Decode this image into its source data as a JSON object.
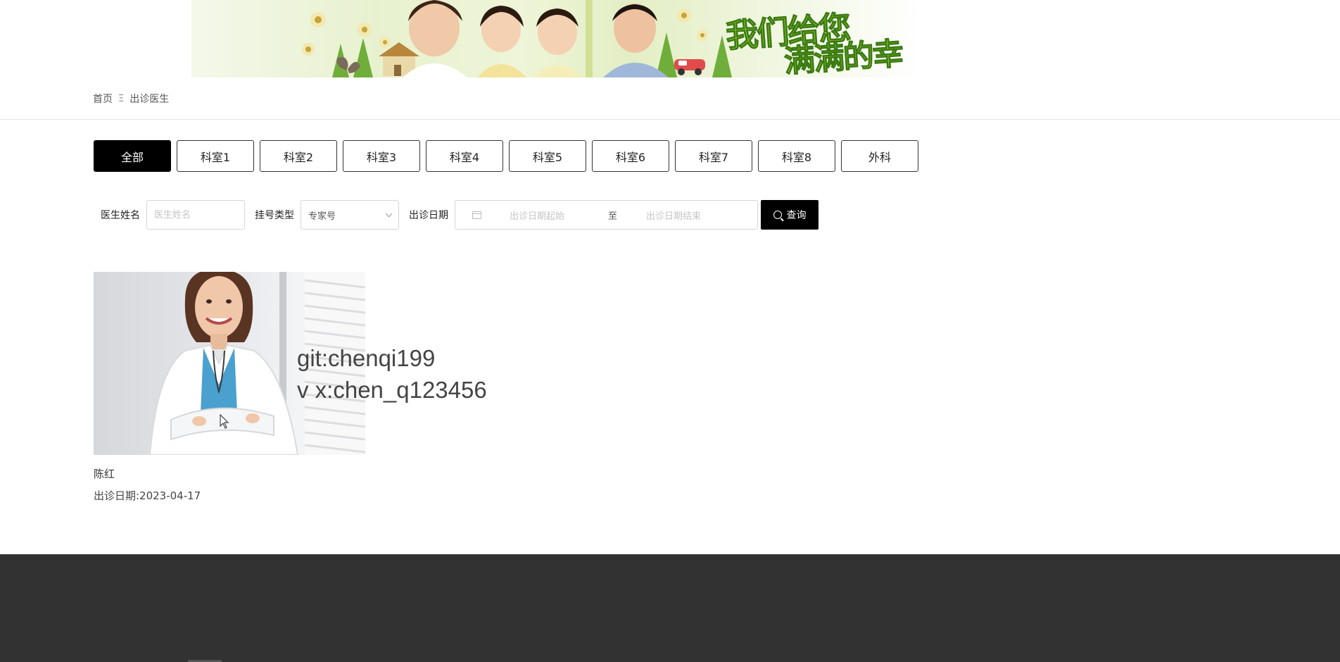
{
  "banner": {
    "slogan_line1": "我们给您",
    "slogan_line2": "满满的幸福"
  },
  "breadcrumb": {
    "home": "首页",
    "separator": "Ξ",
    "current": "出诊医生"
  },
  "departments": [
    {
      "label": "全部",
      "active": true
    },
    {
      "label": "科室1",
      "active": false
    },
    {
      "label": "科室2",
      "active": false
    },
    {
      "label": "科室3",
      "active": false
    },
    {
      "label": "科室4",
      "active": false
    },
    {
      "label": "科室5",
      "active": false
    },
    {
      "label": "科室6",
      "active": false
    },
    {
      "label": "科室7",
      "active": false
    },
    {
      "label": "科室8",
      "active": false
    },
    {
      "label": "外科",
      "active": false
    }
  ],
  "search": {
    "doctor_name_label": "医生姓名",
    "doctor_name_placeholder": "医生姓名",
    "doctor_name_value": "",
    "reg_type_label": "挂号类型",
    "reg_type_value": "专家号",
    "date_label": "出诊日期",
    "date_start_placeholder": "出诊日期起始",
    "date_separator": "至",
    "date_end_placeholder": "出诊日期结束",
    "submit_label": "查询"
  },
  "doctors": [
    {
      "name": "陈红",
      "date_text": "出诊日期:2023-04-17"
    }
  ],
  "watermark": {
    "line1": "git:chenqi199",
    "line2": "v x:chen_q123456"
  },
  "colors": {
    "primary": "#000000",
    "footer_bg": "#323232",
    "slogan_green": "#9bd12d"
  }
}
